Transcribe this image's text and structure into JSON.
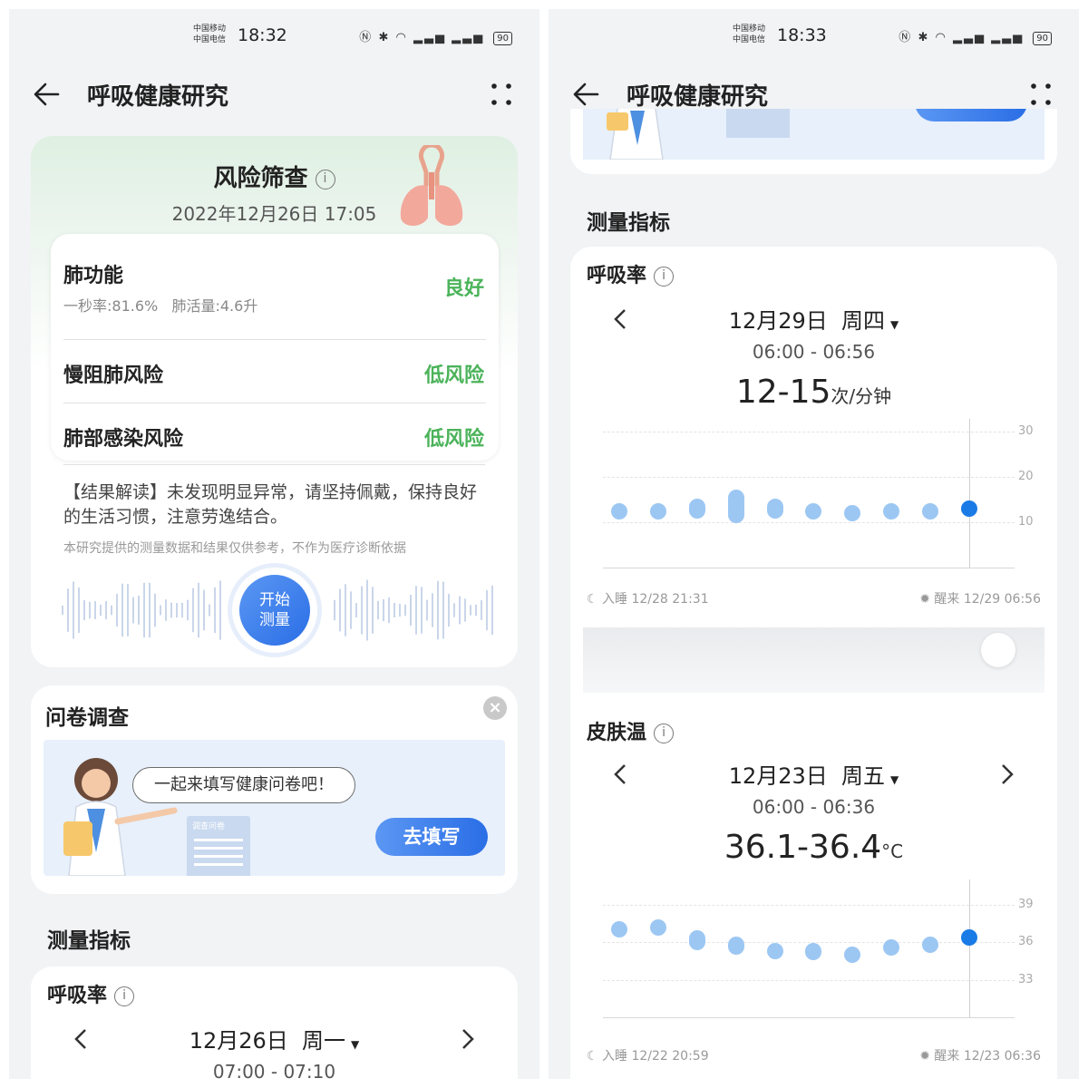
{
  "left": {
    "status": {
      "carrier1": "中国移动",
      "carrier2": "中国电信",
      "time": "18:32",
      "battery": "90"
    },
    "header": {
      "title": "呼吸健康研究"
    },
    "risk": {
      "title": "风险筛查",
      "datetime": "2022年12月26日 17:05",
      "lung_function": {
        "label": "肺功能",
        "detail": "一秒率:81.6%   肺活量:4.6升",
        "status": "良好"
      },
      "copd": {
        "label": "慢阻肺风险",
        "status": "低风险"
      },
      "infection": {
        "label": "肺部感染风险",
        "status": "低风险"
      },
      "interpretation": "【结果解读】未发现明显异常，请坚持佩戴，保持良好的生活习惯，注意劳逸结合。",
      "disclaimer": "本研究提供的测量数据和结果仅供参考，不作为医疗诊断依据",
      "measure_button": [
        "开始",
        "测量"
      ]
    },
    "survey": {
      "title": "问卷调查",
      "bubble": "一起来填写健康问卷吧！",
      "button": "去填写",
      "doc_label": "调查问卷"
    },
    "metrics": {
      "title": "测量指标",
      "resp": {
        "label": "呼吸率",
        "date": "12月26日  周一",
        "range": "07:00 - 07:10"
      }
    }
  },
  "right": {
    "status": {
      "carrier1": "中国移动",
      "carrier2": "中国电信",
      "time": "18:33",
      "battery": "90"
    },
    "header": {
      "title": "呼吸健康研究"
    },
    "metrics_title": "测量指标",
    "resp": {
      "label": "呼吸率",
      "date": "12月29日  周四",
      "range": "06:00 - 06:56",
      "value": "12-15",
      "unit": "次/分钟",
      "sleep": "入睡 12/28 21:31",
      "wake": "醒来 12/29 06:56"
    },
    "skin": {
      "label": "皮肤温",
      "date": "12月23日  周五",
      "range": "06:00 - 06:36",
      "value": "36.1-36.4",
      "unit": "°C",
      "sleep": "入睡 12/22 20:59",
      "wake": "醒来 12/23 06:36"
    }
  },
  "chart_data": [
    {
      "type": "scatter",
      "title": "呼吸率",
      "ylim": [
        0,
        30
      ],
      "yticks": [
        "30",
        "20",
        "10"
      ],
      "x": [
        1,
        2,
        3,
        4,
        5,
        6,
        7,
        8,
        9,
        10
      ],
      "y_low": [
        12,
        12,
        12,
        11,
        12,
        12,
        12,
        12,
        12,
        13
      ],
      "y_high": [
        13,
        13,
        14,
        16,
        14,
        13,
        12,
        13,
        13,
        13
      ]
    },
    {
      "type": "scatter",
      "title": "皮肤温",
      "ylim": [
        30,
        40
      ],
      "yticks": [
        "39",
        "36",
        "33"
      ],
      "x": [
        1,
        2,
        3,
        4,
        5,
        6,
        7,
        8,
        9,
        10
      ],
      "y_low": [
        36.9,
        37.1,
        35.8,
        35.4,
        35.2,
        35.0,
        34.9,
        35.5,
        35.7,
        36.3
      ],
      "y_high": [
        37.1,
        37.3,
        36.5,
        36.0,
        35.4,
        35.5,
        35.1,
        35.7,
        35.9,
        36.5
      ]
    }
  ]
}
